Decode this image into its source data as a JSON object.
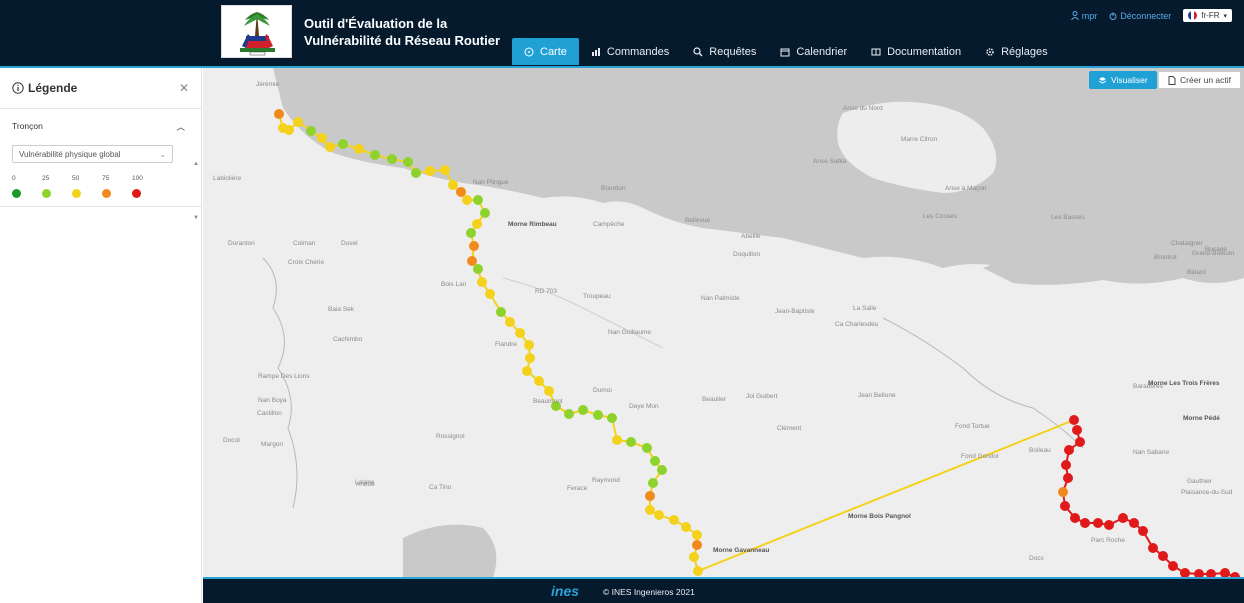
{
  "app": {
    "title": "Outil d'Évaluation de la Vulnérabilité du Réseau Routier"
  },
  "nav": {
    "items": [
      {
        "label": "Carte",
        "icon": "compass-icon",
        "active": true
      },
      {
        "label": "Commandes",
        "icon": "chart-icon"
      },
      {
        "label": "Requêtes",
        "icon": "search-icon"
      },
      {
        "label": "Calendrier",
        "icon": "calendar-icon"
      },
      {
        "label": "Documentation",
        "icon": "book-icon"
      },
      {
        "label": "Réglages",
        "icon": "gear-icon"
      }
    ]
  },
  "user": {
    "name": "mpr",
    "logout": "Déconnecter",
    "language": "fr-FR"
  },
  "legend": {
    "title": "Légende",
    "section": "Tronçon",
    "selected": "Vulnérabilité physique global",
    "scale": [
      {
        "label": "0",
        "color": "#1a9a2b"
      },
      {
        "label": "25",
        "color": "#8ed22c"
      },
      {
        "label": "50",
        "color": "#f4d21c"
      },
      {
        "label": "75",
        "color": "#f08a1c"
      },
      {
        "label": "100",
        "color": "#e01a1a"
      }
    ]
  },
  "map": {
    "visualise": "Visualiser",
    "create": "Créer un actif",
    "labels": [
      {
        "text": "Jérémie",
        "bold": false
      },
      {
        "text": "Anse du Nord"
      },
      {
        "text": "Marre Citron"
      },
      {
        "text": "Anse Sabla"
      },
      {
        "text": "Anse à Maçon"
      },
      {
        "text": "Labiolière"
      },
      {
        "text": "Beaumont"
      },
      {
        "text": "Morne Rimbeau",
        "bold": true
      },
      {
        "text": "Nan Plingue"
      },
      {
        "text": "Campêche"
      },
      {
        "text": "Bellevue"
      },
      {
        "text": "Abeille"
      },
      {
        "text": "Bourdon"
      },
      {
        "text": "Doquillon"
      },
      {
        "text": "Duranton"
      },
      {
        "text": "Colman"
      },
      {
        "text": "Duvel"
      },
      {
        "text": "Croix Chérie"
      },
      {
        "text": "Troupeau"
      },
      {
        "text": "Nan Palmiste"
      },
      {
        "text": "Jean-Baptiste"
      },
      {
        "text": "La Salle"
      },
      {
        "text": "Ca Charlesdeu"
      },
      {
        "text": "Bois Lan"
      },
      {
        "text": "Baia Sek"
      },
      {
        "text": "Nan Guillaume"
      },
      {
        "text": "Cachimbo"
      },
      {
        "text": "Flandre"
      },
      {
        "text": "Rampe Des Lions"
      },
      {
        "text": "Nan Boya"
      },
      {
        "text": "Castillon"
      },
      {
        "text": "Dumoi"
      },
      {
        "text": "Deye Mon"
      },
      {
        "text": "Beaulier"
      },
      {
        "text": "Jol Guibert"
      },
      {
        "text": "Jean Bellune"
      },
      {
        "text": "Baradères"
      },
      {
        "text": "Morne Les Trois Frères",
        "bold": true
      },
      {
        "text": "Morne Pédé",
        "bold": true
      },
      {
        "text": "Docot"
      },
      {
        "text": "Margon"
      },
      {
        "text": "Rossignol"
      },
      {
        "text": "Lalane"
      },
      {
        "text": "Clément"
      },
      {
        "text": "Fond Tortue"
      },
      {
        "text": "Fond Gondol"
      },
      {
        "text": "Boileau"
      },
      {
        "text": "Nan Sabane"
      },
      {
        "text": "Gauthier"
      },
      {
        "text": "Plaisance-du-Sud"
      },
      {
        "text": "Anette"
      },
      {
        "text": "Ca Tino"
      },
      {
        "text": "Raymond"
      },
      {
        "text": "Ferace"
      },
      {
        "text": "Morne Bois Pangnol",
        "bold": true
      },
      {
        "text": "Morne Gavanneau",
        "bold": true
      },
      {
        "text": "Parc Roche"
      },
      {
        "text": "Docs"
      },
      {
        "text": "Grand-Boucan"
      },
      {
        "text": "Chataigner"
      },
      {
        "text": "Bocage"
      },
      {
        "text": "Brostrot"
      },
      {
        "text": "Bidard"
      },
      {
        "text": "Les Cosses"
      },
      {
        "text": "Les Basses"
      },
      {
        "text": "RD 703"
      }
    ]
  },
  "footer": {
    "brand": "ines",
    "copyright": "© INES Ingenieros 2021"
  }
}
